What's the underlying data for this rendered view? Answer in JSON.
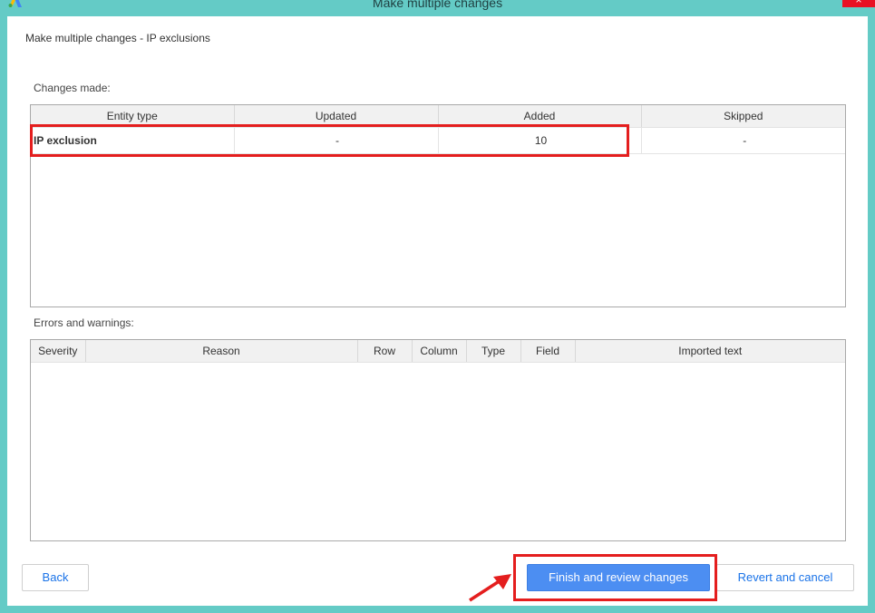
{
  "window": {
    "title": "Make multiple changes",
    "close_label": "×",
    "logo_icon": "google-ads-logo",
    "close_color": "#e81123",
    "frame_color": "#64cbc6"
  },
  "dialog": {
    "subtitle": "Make multiple changes - IP exclusions",
    "changes_label": "Changes made:",
    "errors_label": "Errors and warnings:"
  },
  "changes_table": {
    "columns": [
      "Entity type",
      "Updated",
      "Added",
      "Skipped"
    ],
    "rows": [
      {
        "entity_type": "IP exclusion",
        "updated": "-",
        "added": "10",
        "skipped": "-"
      }
    ]
  },
  "errors_table": {
    "columns": [
      "Severity",
      "Reason",
      "Row",
      "Column",
      "Type",
      "Field",
      "Imported text"
    ]
  },
  "buttons": {
    "back": "Back",
    "finish": "Finish and review changes",
    "revert": "Revert and cancel"
  },
  "annotations": {
    "highlight_color": "#e41e1e",
    "arrow_icon": "red-arrow-icon"
  }
}
